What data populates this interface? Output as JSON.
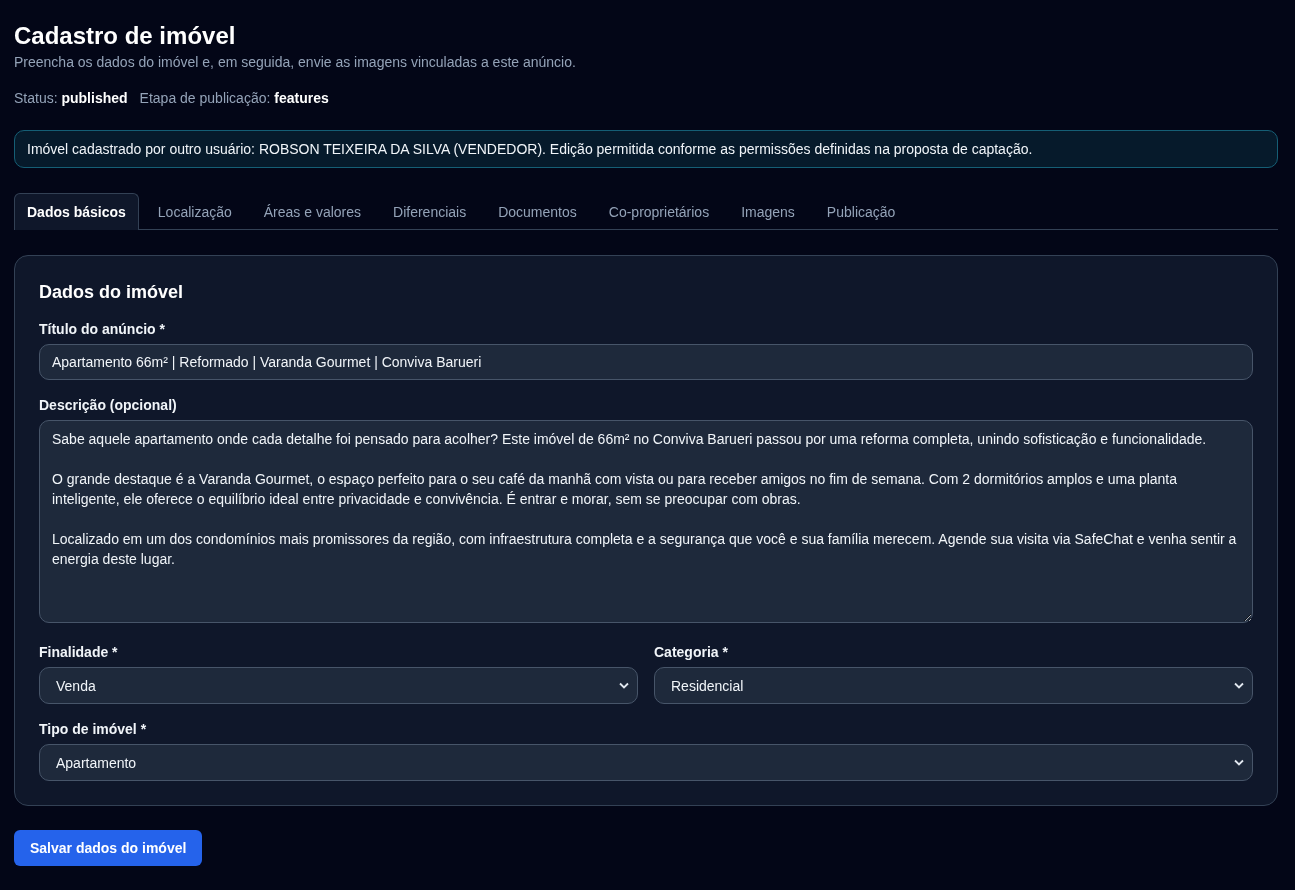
{
  "header": {
    "title": "Cadastro de imóvel",
    "subtitle": "Preencha os dados do imóvel e, em seguida, envie as imagens vinculadas a este anúncio.",
    "meta": [
      "Status: **published**",
      "Etapa de publicação: **features**"
    ]
  },
  "notice": "Imóvel cadastrado por outro usuário: ROBSON TEIXEIRA DA SILVA (VENDEDOR). Edição permitida conforme as permissões definidas na proposta de captação.",
  "tabs": [
    {
      "label": "Dados básicos",
      "selected": true
    },
    {
      "label": "Localização",
      "selected": false
    },
    {
      "label": "Áreas e valores",
      "selected": false
    },
    {
      "label": "Diferenciais",
      "selected": false
    },
    {
      "label": "Documentos",
      "selected": false
    },
    {
      "label": "Co-proprietários",
      "selected": false
    },
    {
      "label": "Imagens",
      "selected": false
    },
    {
      "label": "Publicação",
      "selected": false
    }
  ],
  "card": {
    "title": "Dados do imóvel",
    "fields": [
      {
        "kind": "text",
        "label": "Título do anúncio *",
        "value": "Apartamento 66m² | Reformado | Varanda Gourmet | Conviva Barueri"
      },
      {
        "kind": "textarea",
        "label": "Descrição (opcional)",
        "value": "Sabe aquele apartamento onde cada detalhe foi pensado para acolher? Este imóvel de 66m² no Conviva Barueri passou por uma reforma completa, unindo sofisticação e funcionalidade.\n\nO grande destaque é a Varanda Gourmet, o espaço perfeito para o seu café da manhã com vista ou para receber amigos no fim de semana. Com 2 dormitórios amplos e uma planta inteligente, ele oferece o equilíbrio ideal entre privacidade e convivência. É entrar e morar, sem se preocupar com obras.\n\nLocalizado em um dos condomínios mais promissores da região, com infraestrutura completa e a segurança que você e sua família merecem. Agende sua visita via SafeChat e venha sentir a energia deste lugar."
      },
      {
        "kind": "select",
        "label": "Finalidade *",
        "value": "Venda",
        "half": true
      },
      {
        "kind": "select",
        "label": "Categoria *",
        "value": "Residencial",
        "half": true
      },
      {
        "kind": "select",
        "label": "Tipo de imóvel *",
        "value": "Apartamento"
      }
    ]
  },
  "save_button": "Salvar dados do imóvel"
}
